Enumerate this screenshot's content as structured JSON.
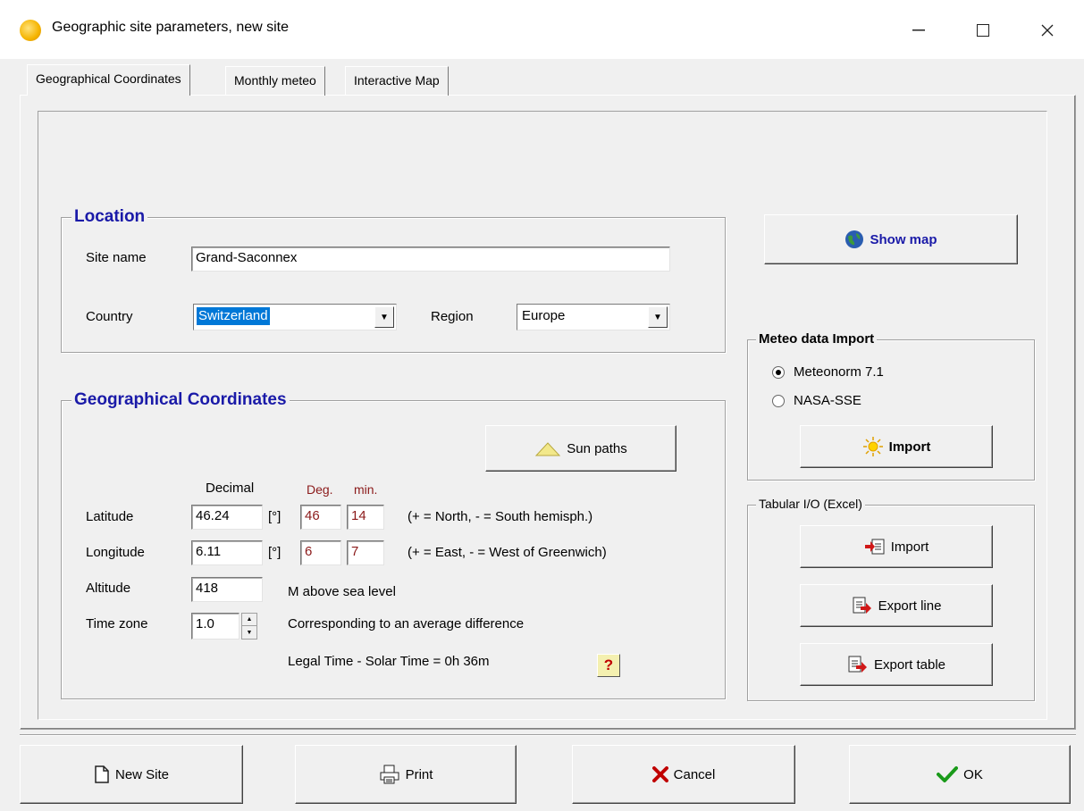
{
  "window": {
    "title": "Geographic site parameters, new site",
    "minimize": "—",
    "maximize": "☐",
    "close": "✕"
  },
  "tabs": [
    {
      "label": "Geographical Coordinates",
      "active": true
    },
    {
      "label": "Monthly meteo",
      "active": false
    },
    {
      "label": "Interactive Map",
      "active": false
    }
  ],
  "location": {
    "legend": "Location",
    "site_name_label": "Site name",
    "site_name_value": "Grand-Saconnex",
    "country_label": "Country",
    "country_value": "Switzerland",
    "region_label": "Region",
    "region_value": "Europe"
  },
  "coords": {
    "legend": "Geographical Coordinates",
    "sun_paths_button": "Sun paths",
    "decimal_header": "Decimal",
    "deg_header": "Deg.",
    "min_header": "min.",
    "latitude_label": "Latitude",
    "latitude_decimal": "46.24",
    "latitude_unit": "[°]",
    "latitude_deg": "46",
    "latitude_min": "14",
    "latitude_hint": "(+ = North,  - = South hemisph.)",
    "longitude_label": "Longitude",
    "longitude_decimal": "6.11",
    "longitude_unit": "[°]",
    "longitude_deg": "6",
    "longitude_min": "7",
    "longitude_hint": "(+ = East, - = West of Greenwich)",
    "altitude_label": "Altitude",
    "altitude_value": "418",
    "altitude_unit": "M above sea level",
    "timezone_label": "Time zone",
    "timezone_value": "1.0",
    "timezone_hint": "Corresponding to an average difference",
    "legal_time_text": "Legal Time - Solar Time =   0h 36m",
    "help_button": "?"
  },
  "show_map_button": "Show map",
  "meteo_import": {
    "legend": "Meteo data Import",
    "option_meteonorm": "Meteonorm 7.1",
    "option_nasa": "NASA-SSE",
    "selected": "Meteonorm 7.1",
    "import_button": "Import"
  },
  "tabular": {
    "legend": "Tabular I/O (Excel)",
    "import_button": "Import",
    "export_line_button": "Export line",
    "export_table_button": "Export table"
  },
  "footer": {
    "new_site": "New Site",
    "print": "Print",
    "cancel": "Cancel",
    "ok": "OK"
  },
  "colors": {
    "legend_blue": "#1a1aa8",
    "deg_red": "#8b1a1a",
    "cancel_red": "#c00000",
    "ok_green": "#1a9a1a",
    "selection_blue": "#0078d7"
  }
}
